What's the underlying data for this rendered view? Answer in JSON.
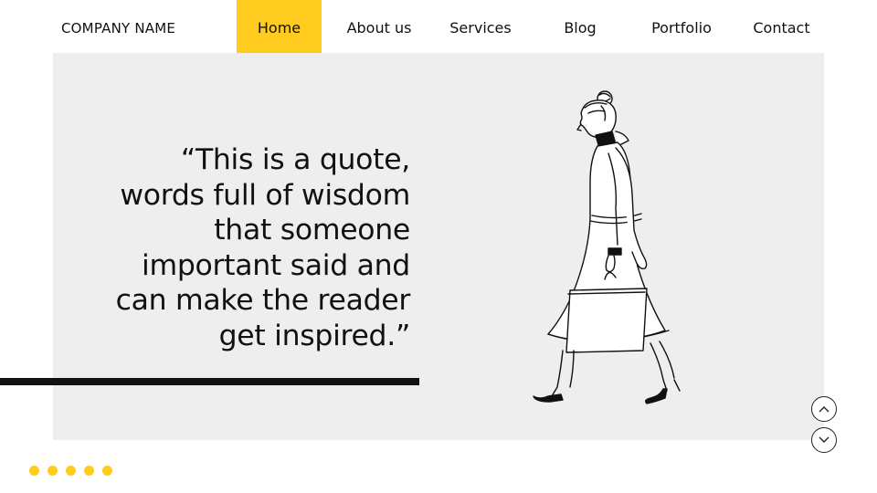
{
  "brand": {
    "name": "COMPANY NAME"
  },
  "nav": {
    "items": [
      {
        "label": "Home",
        "active": true
      },
      {
        "label": "About us"
      },
      {
        "label": "Services"
      },
      {
        "label": "Blog"
      },
      {
        "label": "Portfolio"
      },
      {
        "label": "Contact"
      }
    ]
  },
  "hero": {
    "quote_lines": [
      "“This is a quote,",
      "words full of wisdom",
      "that someone",
      "important said and",
      "can make the reader",
      "get inspired.”"
    ],
    "illustration": "woman-walking-with-shopping-bag"
  },
  "controls": {
    "up_icon": "chevron-up-icon",
    "down_icon": "chevron-down-icon"
  },
  "pagination": {
    "dots": 5
  },
  "colors": {
    "accent": "#ffcb1e",
    "panel": "#eeeeee",
    "text": "#111111"
  }
}
